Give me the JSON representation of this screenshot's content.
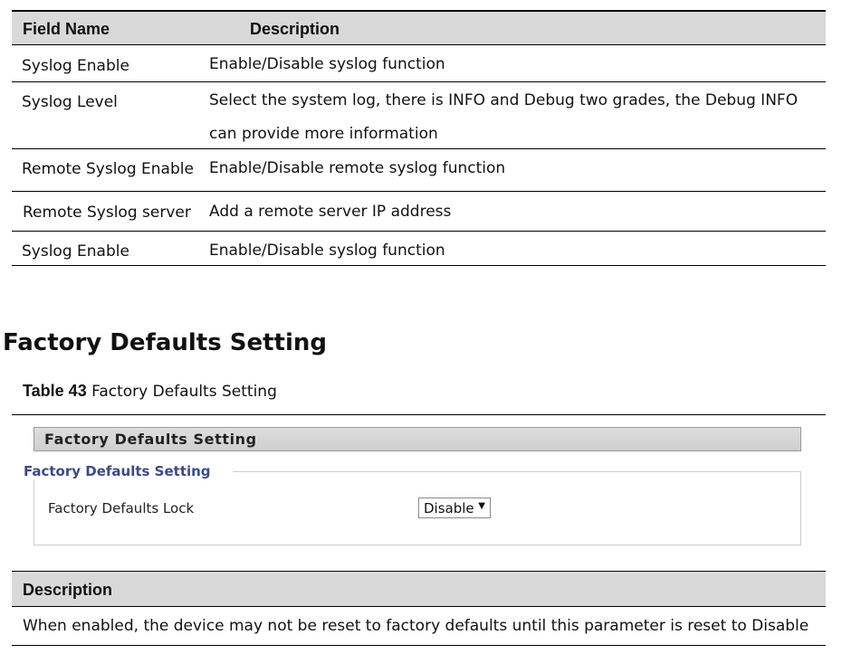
{
  "field_table": {
    "headers": [
      "Field Name",
      "Description"
    ],
    "rows": [
      {
        "field": "Syslog Enable",
        "description": "Enable/Disable syslog function"
      },
      {
        "field": "Syslog Level",
        "description": "Select the system log, there is INFO and Debug two grades, the Debug INFO can provide more information"
      },
      {
        "field": "Remote Syslog Enable",
        "description": "Enable/Disable remote syslog function"
      },
      {
        "field": "Remote Syslog server",
        "description": "Add a remote server IP address"
      },
      {
        "field": "Syslog Enable",
        "description": "Enable/Disable syslog function"
      }
    ]
  },
  "section": {
    "title": "Factory Defaults Setting",
    "caption_label": "Table 43",
    "caption_text": "Factory Defaults Setting"
  },
  "panel": {
    "header": "Factory Defaults Setting",
    "legend": "Factory Defaults Setting",
    "field_label": "Factory Defaults Lock",
    "select_value": "Disable",
    "select_arrow": "▼"
  },
  "description_table": {
    "header": "Description",
    "text": "When enabled, the device may not be reset to factory defaults until this parameter is reset to Disable"
  }
}
